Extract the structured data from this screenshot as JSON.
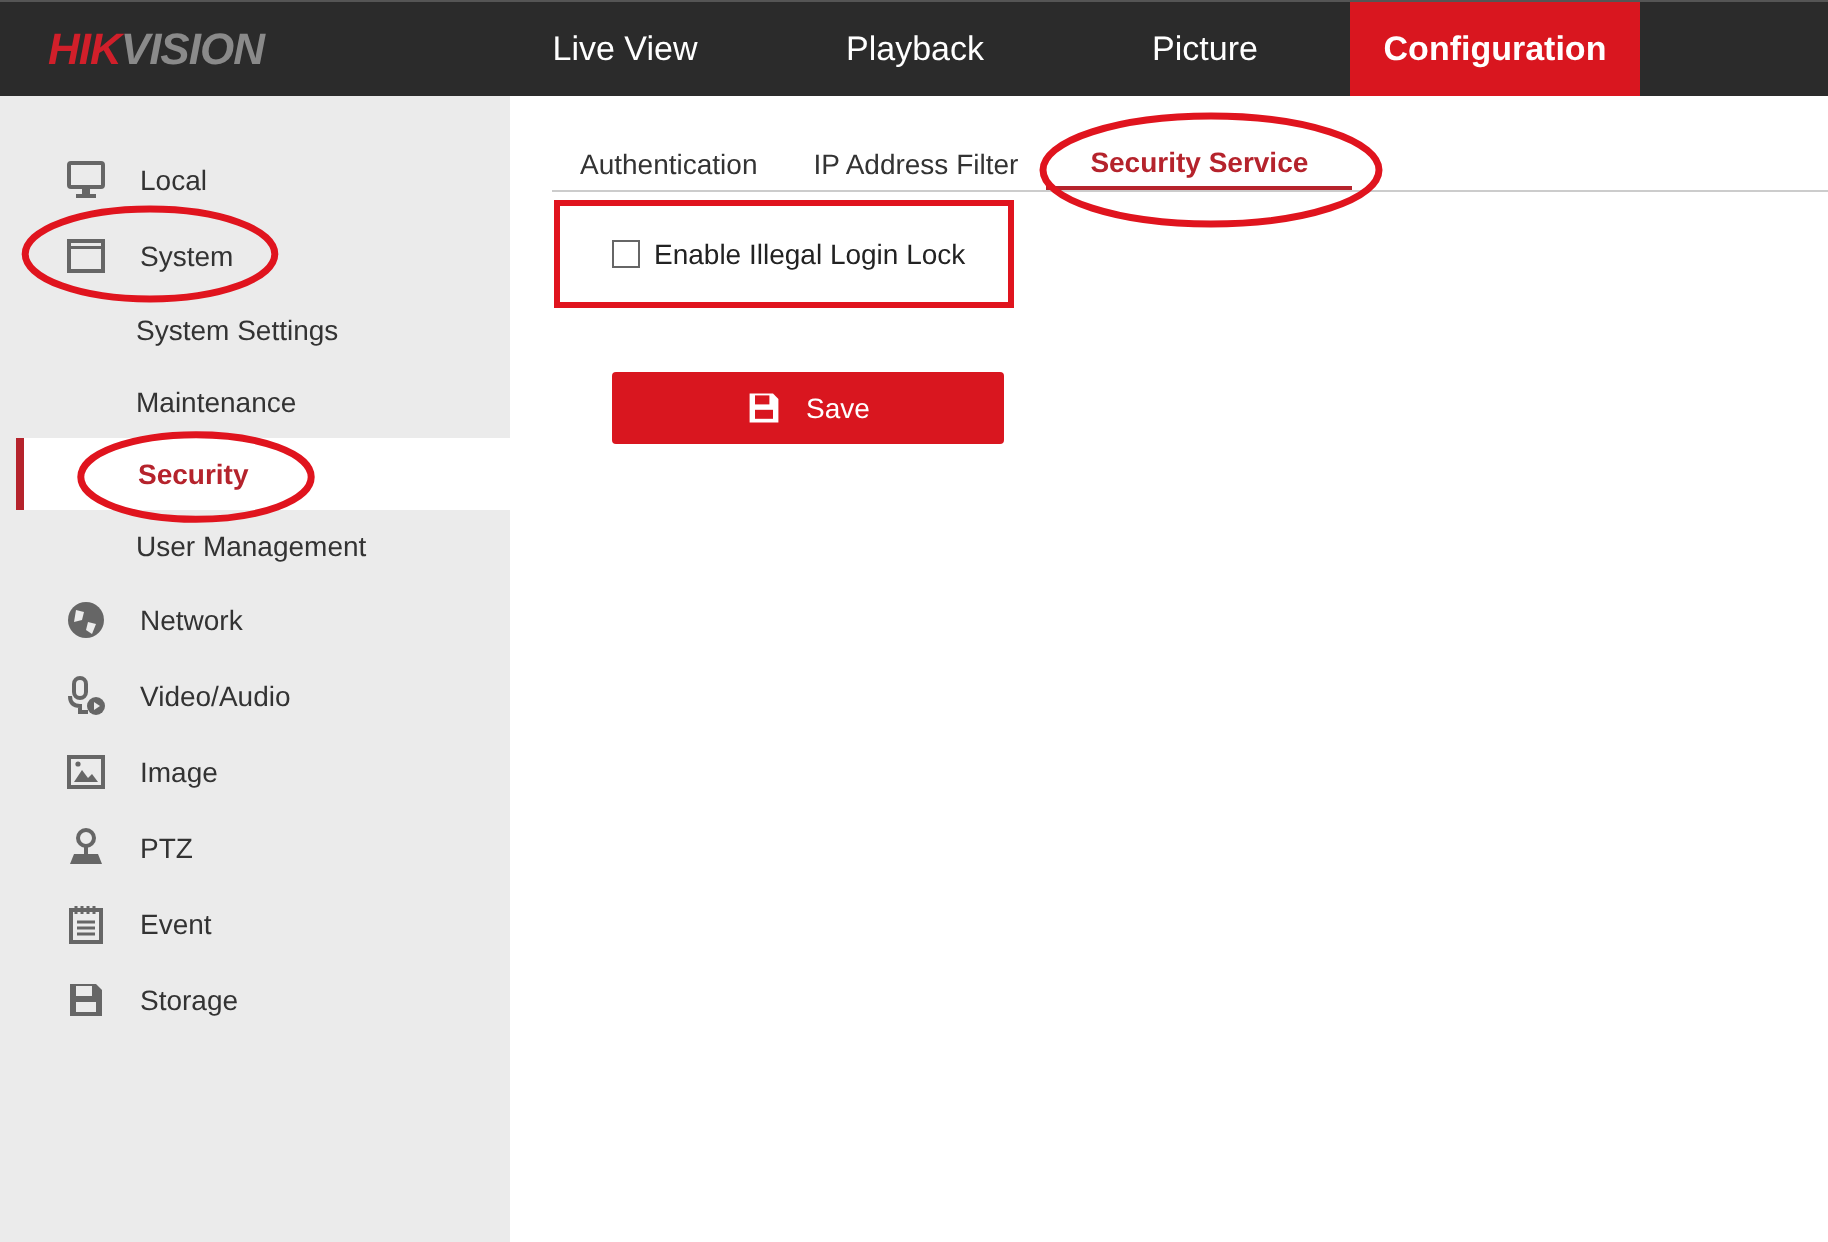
{
  "logo": {
    "accent": "HIK",
    "rest": "VISION"
  },
  "nav": [
    {
      "label": "Live View",
      "selected": false
    },
    {
      "label": "Playback",
      "selected": false
    },
    {
      "label": "Picture",
      "selected": false
    },
    {
      "label": "Configuration",
      "selected": true
    }
  ],
  "sidebar": {
    "items": [
      {
        "label": "Local",
        "circled": false
      },
      {
        "label": "System",
        "circled": true,
        "children": [
          {
            "label": "System Settings",
            "selected": false,
            "circled": false
          },
          {
            "label": "Maintenance",
            "selected": false,
            "circled": false
          },
          {
            "label": "Security",
            "selected": true,
            "circled": true
          },
          {
            "label": "User Management",
            "selected": false,
            "circled": false
          }
        ]
      },
      {
        "label": "Network",
        "circled": false
      },
      {
        "label": "Video/Audio",
        "circled": false
      },
      {
        "label": "Image",
        "circled": false
      },
      {
        "label": "PTZ",
        "circled": false
      },
      {
        "label": "Event",
        "circled": false
      },
      {
        "label": "Storage",
        "circled": false
      }
    ]
  },
  "tabs": [
    {
      "label": "Authentication",
      "selected": false,
      "circled": false
    },
    {
      "label": "IP Address Filter",
      "selected": false,
      "circled": false
    },
    {
      "label": "Security Service",
      "selected": true,
      "circled": true
    }
  ],
  "options": [
    {
      "label": "Enable Illegal Login Lock",
      "checked": false,
      "boxed": true
    }
  ],
  "save_button": {
    "label": "Save"
  }
}
